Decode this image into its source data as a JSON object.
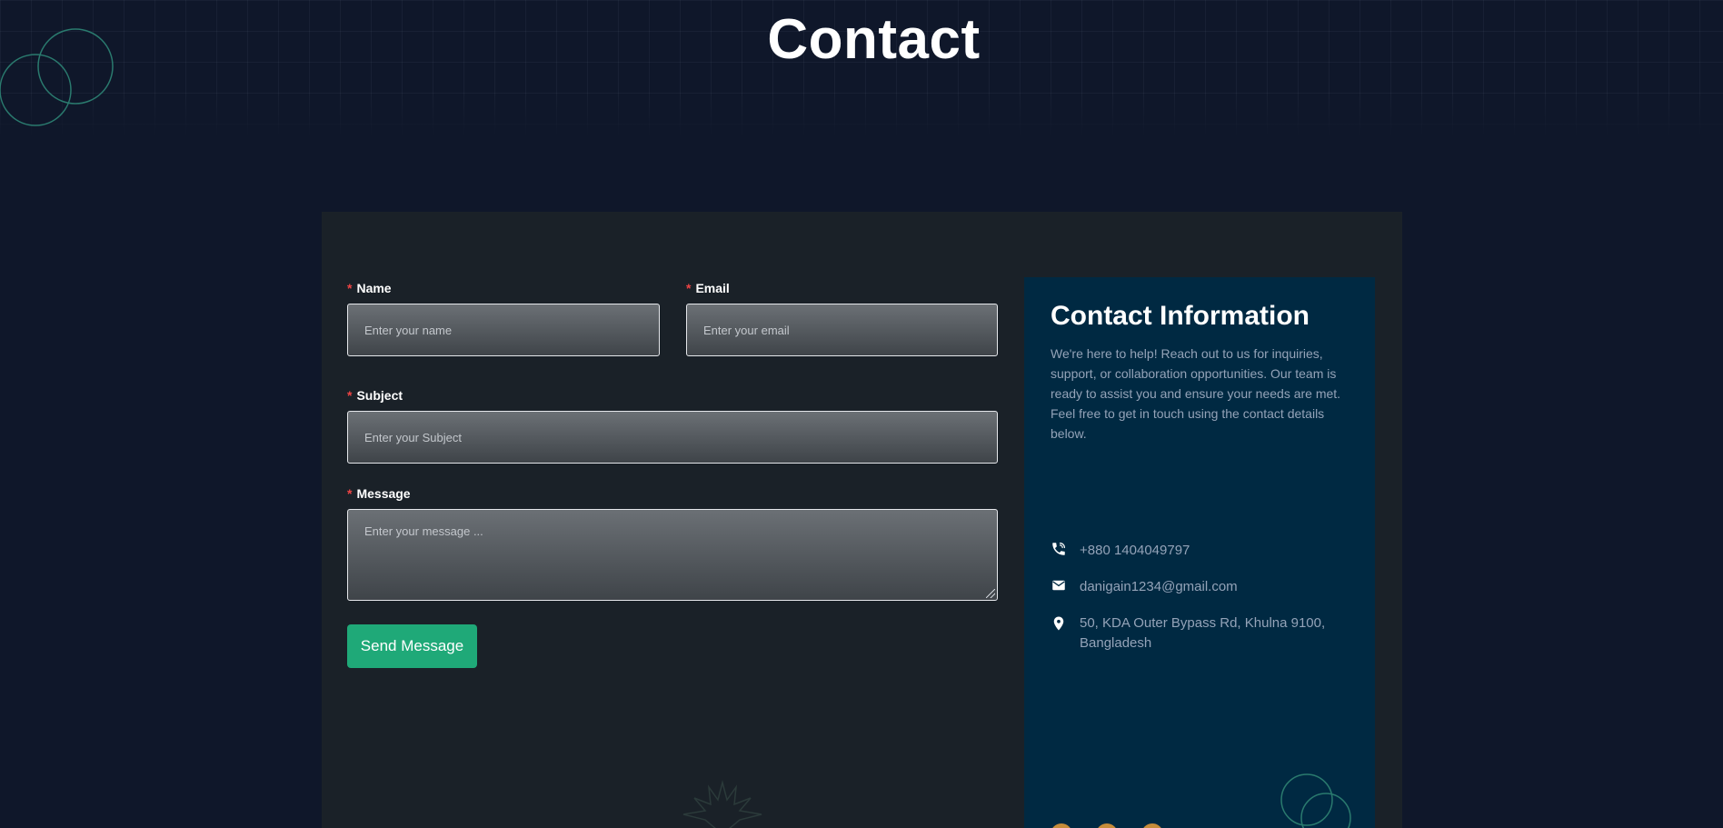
{
  "page": {
    "title": "Contact"
  },
  "form": {
    "name": {
      "label": "Name",
      "required_mark": "*",
      "placeholder": "Enter your name",
      "value": ""
    },
    "email": {
      "label": "Email",
      "required_mark": "*",
      "placeholder": "Enter your email",
      "value": ""
    },
    "subject": {
      "label": "Subject",
      "required_mark": "*",
      "placeholder": "Enter your Subject",
      "value": ""
    },
    "message": {
      "label": "Message",
      "required_mark": "*",
      "placeholder": "Enter your message ...",
      "value": ""
    },
    "submit_label": "Send Message"
  },
  "contact_info": {
    "title": "Contact Information",
    "description": "We're here to help! Reach out to us for inquiries, support, or collaboration opportunities. Our team is ready to assist you and ensure your needs are met. Feel free to get in touch using the contact details below.",
    "phone": {
      "icon": "phone-icon",
      "text": "+880 1404049797"
    },
    "email": {
      "icon": "mail-icon",
      "text": "danigain1234@gmail.com"
    },
    "address": {
      "icon": "location-pin-icon",
      "text": "50, KDA Outer Bypass Rd, Khulna 9100, Bangladesh"
    }
  },
  "colors": {
    "background": "#0f172a",
    "card": "#1a2128",
    "info_panel": "#002942",
    "accent": "#1fa978",
    "required": "#ef4444",
    "decor_circle": "#2a7a6e",
    "social_icon": "#c68c3a"
  }
}
